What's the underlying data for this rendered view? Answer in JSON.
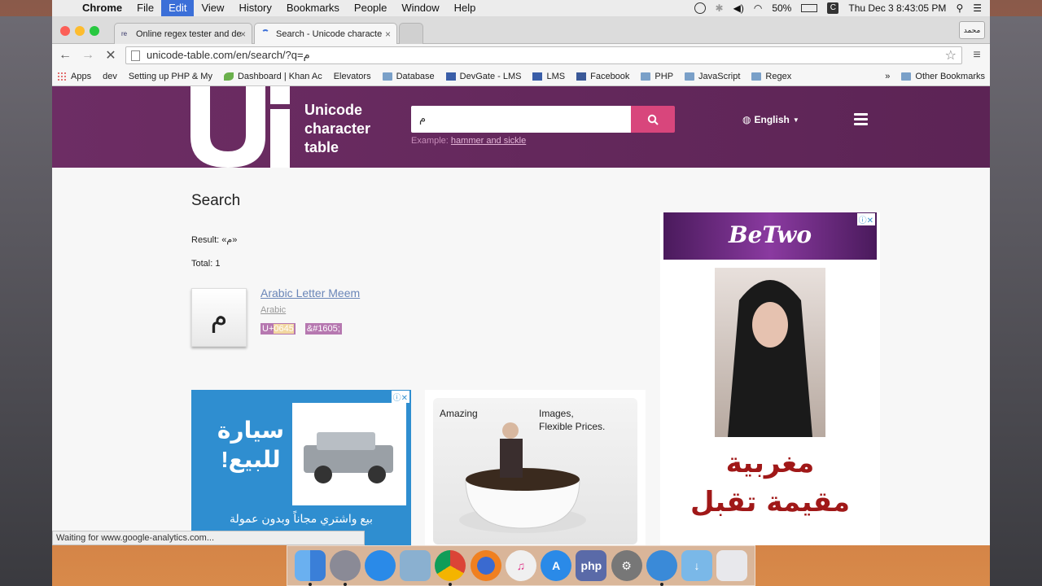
{
  "menubar": {
    "app": "Chrome",
    "items": [
      "File",
      "Edit",
      "View",
      "History",
      "Bookmarks",
      "People",
      "Window",
      "Help"
    ],
    "active_item": "Edit",
    "battery": "50%",
    "clock": "Thu Dec 3  8:43:05 PM"
  },
  "browser": {
    "tabs": [
      {
        "title": "Online regex tester and de",
        "favicon": "regex-favicon"
      },
      {
        "title": "Search - Unicode characte",
        "favicon": "loading-spinner"
      }
    ],
    "profile_label": "محمد",
    "url": "unicode-table.com/en/search/?q=م",
    "bookmarks": [
      {
        "label": "Apps",
        "icon": "apps"
      },
      {
        "label": "dev",
        "icon": "page"
      },
      {
        "label": "Setting up PHP & My",
        "icon": "page"
      },
      {
        "label": "Dashboard | Khan Ac",
        "icon": "green"
      },
      {
        "label": "Elevators",
        "icon": "page"
      },
      {
        "label": "Database",
        "icon": "folder"
      },
      {
        "label": "DevGate - LMS",
        "icon": "blue"
      },
      {
        "label": "LMS",
        "icon": "blue"
      },
      {
        "label": "Facebook",
        "icon": "fb"
      },
      {
        "label": "PHP",
        "icon": "folder"
      },
      {
        "label": "JavaScript",
        "icon": "folder"
      },
      {
        "label": "Regex",
        "icon": "folder"
      }
    ],
    "bookmarks_more": "»",
    "other_bookmarks": "Other Bookmarks"
  },
  "site": {
    "logo_text": [
      "Unicode",
      "character",
      "table"
    ],
    "search_value": "م",
    "example_label": "Example:",
    "example_link": "hammer and sickle",
    "language": "English"
  },
  "results": {
    "heading": "Search",
    "result_text": "Result: «م»",
    "total_text": "Total: 1",
    "char": "م",
    "char_name": "Arabic Letter Meem",
    "char_block": "Arabic",
    "code_prefix": "U+",
    "code_hex": "0645",
    "html_entity": "&#1605;"
  },
  "ads": {
    "car_text_lines": [
      "سيارة",
      "للبيع!"
    ],
    "car_bottom": "بيع واشتري مجاناً وبدون عمولة",
    "cup_text_1": "Amazing",
    "cup_text_2": "Images,",
    "cup_text_3": "Flexible Prices.",
    "side_banner": "BeTwo",
    "side_arabic": [
      "مغربية",
      "مقيمة تقبل"
    ]
  },
  "status_text": "Waiting for www.google-analytics.com...",
  "dock": [
    "Finder",
    "Launchpad",
    "Safari",
    "Preview",
    "Chrome",
    "Firefox",
    "iTunes",
    "App Store",
    "PHP",
    "System Preferences",
    "QuickTime",
    "Downloads",
    "Trash"
  ]
}
